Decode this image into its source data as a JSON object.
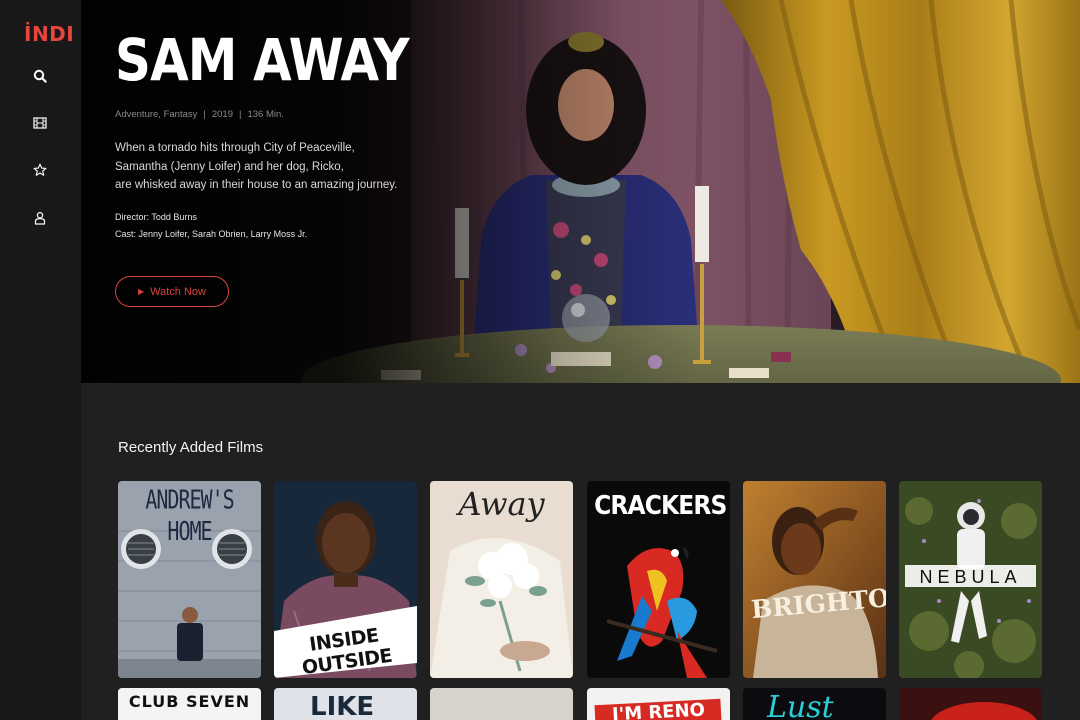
{
  "brand": {
    "logo": "İNDI"
  },
  "sidebar": {
    "items": [
      {
        "name": "search",
        "icon": "search-icon"
      },
      {
        "name": "films",
        "icon": "film-icon"
      },
      {
        "name": "favorites",
        "icon": "star-icon"
      },
      {
        "name": "profile",
        "icon": "user-icon"
      }
    ]
  },
  "hero": {
    "title": "SAM AWAY",
    "genre": "Adventure, Fantasy",
    "year": "2019",
    "duration": "136 Min.",
    "synopsis_lines": [
      "When a tornado hits through City of Peaceville,",
      "Samantha (Jenny Loifer) and her dog, Ricko,",
      "are whisked away in their house to an amazing journey."
    ],
    "director": "Director: Todd Burns",
    "cast": "Cast: Jenny Loifer, Sarah Obrien, Larry Moss Jr.",
    "watch_label": "Watch Now"
  },
  "recent": {
    "heading": "Recently Added Films",
    "films": [
      {
        "title": "ANDREW'S HOME"
      },
      {
        "title": "INSIDE OUTSIDE"
      },
      {
        "title": "Away"
      },
      {
        "title": "CRACKERS"
      },
      {
        "title": "BRIGHTON"
      },
      {
        "title": "NEBULA"
      }
    ],
    "second_row": [
      {
        "title": "CLUB SEVEN"
      },
      {
        "title": "LIKE"
      },
      {
        "title": ""
      },
      {
        "title": "I'M RENO"
      },
      {
        "title": "Lust"
      },
      {
        "title": ""
      }
    ]
  },
  "colors": {
    "accent": "#e8453c",
    "sidebar": "#181818",
    "background": "#202020"
  }
}
